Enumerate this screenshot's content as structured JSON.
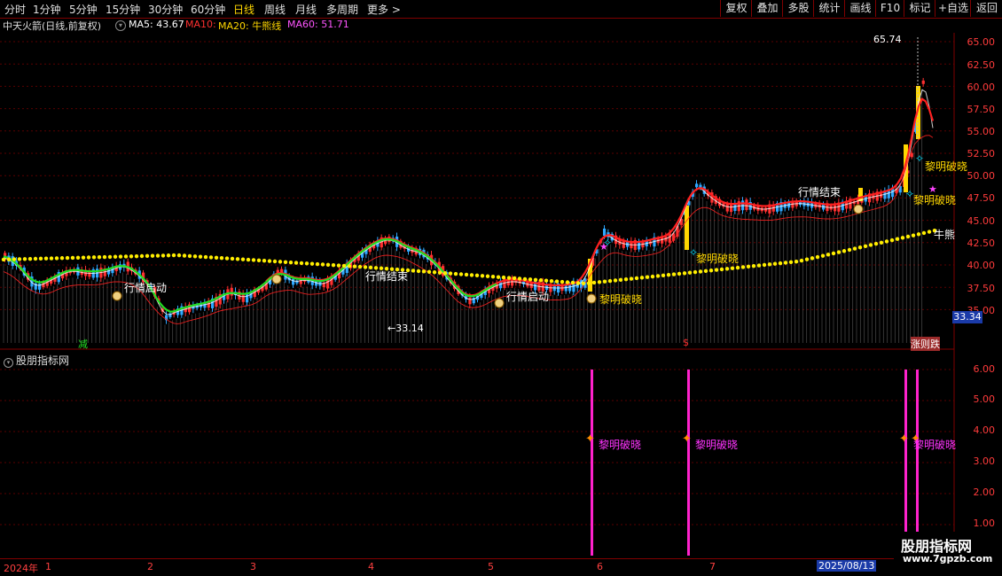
{
  "toolbar": {
    "periods": [
      "分时",
      "1分钟",
      "5分钟",
      "15分钟",
      "30分钟",
      "60分钟",
      "日线",
      "周线",
      "月线",
      "多周期",
      "更多 >"
    ],
    "active_period": "日线",
    "buttons": [
      "复权",
      "叠加",
      "多股",
      "统计",
      "画线",
      "F10",
      "标记",
      "+自选",
      "返回"
    ]
  },
  "infobar": {
    "stock_name": "中天火箭(日线,前复权)",
    "ma5": "MA5: 43.67",
    "ma10": "MA10:",
    "ma20": "MA20: 牛熊线",
    "ma60": "MA60: 51.71"
  },
  "colors": {
    "up": "#ff3030",
    "down": "#2ea8ff",
    "ma5": "#ffffff",
    "ma10": "#ff2020",
    "ma20": "#ffd700",
    "ma60": "#ff00ff",
    "green_line": "#22dd22",
    "dot": "#ffee00",
    "magenta": "#ff22cc"
  },
  "price_axis": {
    "labels": [
      "65.00",
      "62.50",
      "60.00",
      "57.50",
      "55.00",
      "52.50",
      "50.00",
      "47.50",
      "45.00",
      "42.50",
      "40.00",
      "37.50",
      "35.00"
    ],
    "current": "33.34"
  },
  "annotations": {
    "high": "65.74",
    "low": "33.14",
    "start": "行情启动",
    "end": "行情结束",
    "dawn": "黎明破晓",
    "bull": "牛熊",
    "jian": "减",
    "s_mark": "$",
    "bottom_right": "涨则跌"
  },
  "lower_pane": {
    "title": "股朋指标网",
    "axis": [
      "6.00",
      "5.00",
      "4.00",
      "3.00",
      "2.00",
      "1.00"
    ]
  },
  "date_axis": {
    "year": "2024年",
    "months": [
      "1",
      "2",
      "3",
      "4",
      "5",
      "6",
      "7"
    ],
    "current_date": "2025/08/13"
  },
  "watermark": {
    "title": "股朋指标网",
    "url": "www.7gpzb.com"
  }
}
